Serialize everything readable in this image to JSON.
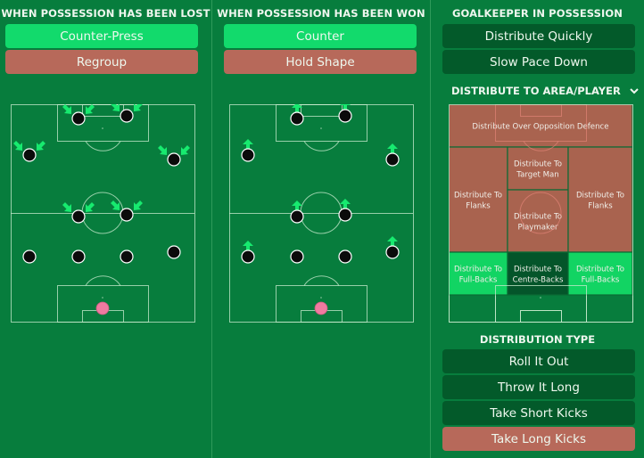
{
  "colors": {
    "background": "#077d3d",
    "selected_green": "#12da6c",
    "selected_red": "#b7695a",
    "unselected_dark": "#035a2a",
    "arrow": "#17ea6f",
    "player": "#0b0b0b",
    "goalkeeper": "#f07aa0",
    "zone_red": "#a9634f",
    "zone_green": "#12d463",
    "zone_dark": "#04552a"
  },
  "lost_panel": {
    "title": "WHEN POSSESSION HAS BEEN LOST",
    "options": [
      {
        "label": "Counter-Press",
        "state": "selected-green"
      },
      {
        "label": "Regroup",
        "state": "selected-red"
      }
    ],
    "arrow_style": "diagonal-press"
  },
  "won_panel": {
    "title": "WHEN POSSESSION HAS BEEN WON",
    "options": [
      {
        "label": "Counter",
        "state": "selected-green"
      },
      {
        "label": "Hold Shape",
        "state": "selected-red"
      }
    ],
    "arrow_style": "forward"
  },
  "gk_panel": {
    "title": "GOALKEEPER IN POSSESSION",
    "options": [
      {
        "label": "Distribute Quickly",
        "state": "unselected"
      },
      {
        "label": "Slow Pace Down",
        "state": "unselected"
      }
    ],
    "distribute_to": {
      "title": "DISTRIBUTE TO AREA/PLAYER",
      "expand_icon": "chevron-down-icon",
      "zones": [
        {
          "label": "Distribute Over Opposition Defence",
          "lines": [
            "Distribute Over Opposition Defence"
          ],
          "state": "red"
        },
        {
          "label": "Distribute To Flanks (left)",
          "lines": [
            "Distribute To",
            "Flanks"
          ],
          "state": "red"
        },
        {
          "label": "Distribute To Target Man",
          "lines": [
            "Distribute To",
            "Target Man"
          ],
          "state": "red"
        },
        {
          "label": "Distribute To Playmaker",
          "lines": [
            "Distribute To",
            "Playmaker"
          ],
          "state": "red"
        },
        {
          "label": "Distribute To Flanks (right)",
          "lines": [
            "Distribute To",
            "Flanks"
          ],
          "state": "red"
        },
        {
          "label": "Distribute To Full-Backs (left)",
          "lines": [
            "Distribute To",
            "Full-Backs"
          ],
          "state": "green"
        },
        {
          "label": "Distribute To Centre-Backs",
          "lines": [
            "Distribute To",
            "Centre-Backs"
          ],
          "state": "dark"
        },
        {
          "label": "Distribute To Full-Backs (right)",
          "lines": [
            "Distribute To",
            "Full-Backs"
          ],
          "state": "green"
        }
      ]
    },
    "distribution_type": {
      "title": "DISTRIBUTION TYPE",
      "options": [
        {
          "label": "Roll It Out",
          "state": "unselected"
        },
        {
          "label": "Throw It Long",
          "state": "unselected"
        },
        {
          "label": "Take Short Kicks",
          "state": "unselected"
        },
        {
          "label": "Take Long Kicks",
          "state": "selected-red"
        }
      ]
    }
  }
}
